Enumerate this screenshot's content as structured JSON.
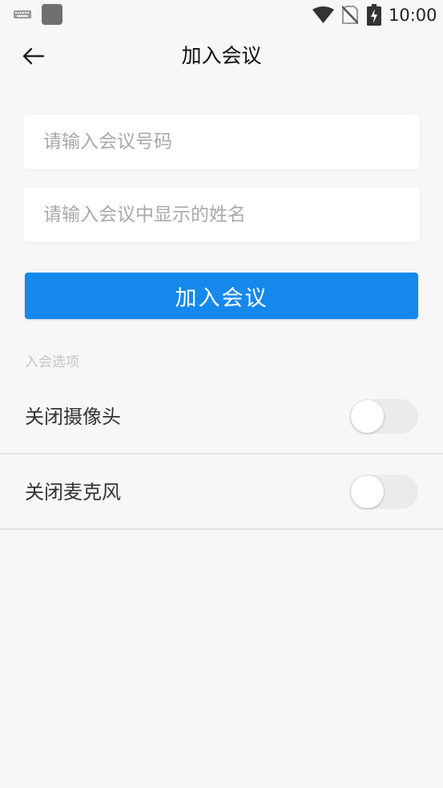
{
  "status_bar": {
    "time": "10:00",
    "icons": [
      "keyboard-icon",
      "app-notification-icon",
      "wifi-icon",
      "no-sim-icon",
      "battery-charging-icon"
    ]
  },
  "header": {
    "title": "加入会议",
    "back_icon": "arrow-left-icon"
  },
  "form": {
    "meeting_number": {
      "value": "",
      "placeholder": "请输入会议号码"
    },
    "display_name": {
      "value": "",
      "placeholder": "请输入会议中显示的姓名"
    },
    "join_button_label": "加入会议"
  },
  "options": {
    "section_label": "入会选项",
    "items": [
      {
        "label": "关闭摄像头",
        "enabled": false
      },
      {
        "label": "关闭麦克风",
        "enabled": false
      }
    ]
  },
  "colors": {
    "primary": "#1589eb",
    "background": "#f7f7f7",
    "toggle_off_track": "#ebebeb"
  }
}
